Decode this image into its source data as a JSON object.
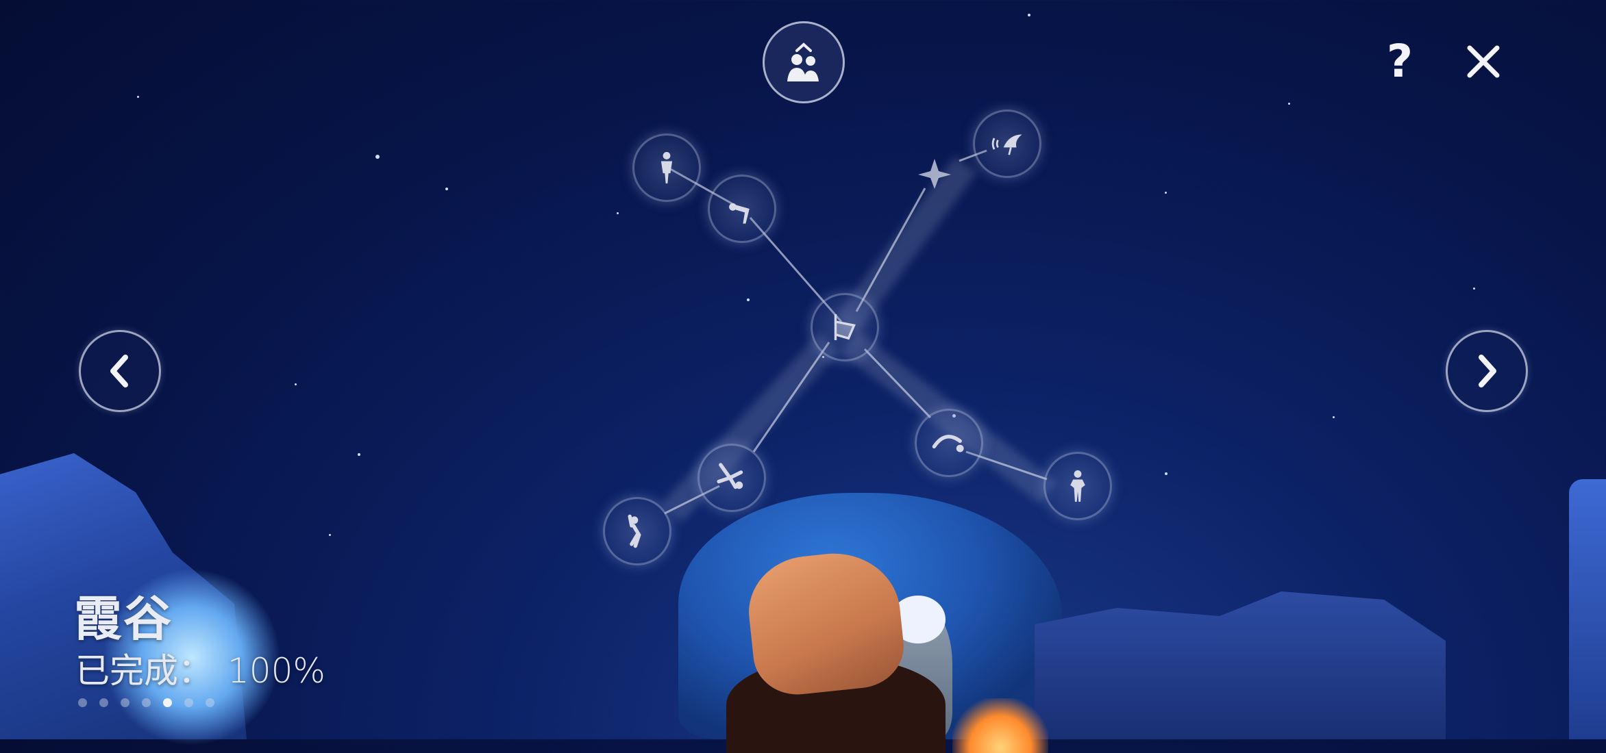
{
  "area": {
    "name": "霞谷",
    "progress_label": "已完成：",
    "progress_value": "100%"
  },
  "pagination": {
    "total": 7,
    "active_index": 4
  },
  "buttons": {
    "friends": "friends-icon",
    "help": "?",
    "close": "✕",
    "prev": "chevron-left-icon",
    "next": "chevron-right-icon"
  },
  "constellation": {
    "center": "spirit-gate-icon",
    "spirits": [
      "stand-emote-spirit",
      "bow-emote-spirit",
      "call-emote-spirit",
      "cartwheel-emote-spirit",
      "stretch-emote-spirit",
      "backflip-emote-spirit",
      "pose-emote-spirit"
    ]
  }
}
